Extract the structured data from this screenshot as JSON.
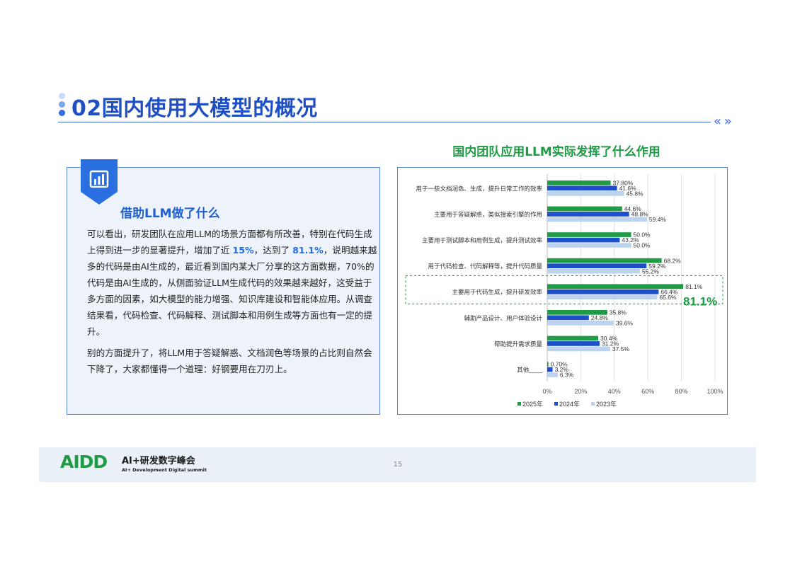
{
  "header": {
    "title": "02国内使用大模型的概况",
    "dot_colors": [
      "#c9dafc",
      "#7ea6ef",
      "#2f6ee3"
    ]
  },
  "text_box": {
    "heading": "借助LLM做了什么",
    "para1": {
      "part1": "可以看出，研发团队在应用LLM的场景方面都有所改善，特别在代码生成上得到进一步的显著提升，增加了近 ",
      "hl1": "15%",
      "part2": "，达到了 ",
      "hl2": "81.1%",
      "part3": "，说明越来越多的代码是由AI生成的，最近看到国内某大厂分享的这方面数据，70%的代码是由AI生成的，从侧面验证LLM生成代码的效果越来越好，这受益于多方面的因素，如大模型的能力增强、知识库建设和智能体应用。从调查结果看，代码检查、代码解释、测试脚本和用例生成等方面也有一定的提升。"
    },
    "para2": "别的方面提升了，将LLM用于答疑解惑、文档润色等场景的占比则自然会下降了，大家都懂得一个道理：好钢要用在刀刃上。"
  },
  "chart_data": {
    "type": "bar",
    "orientation": "horizontal",
    "title": "国内团队应用LLM实际发挥了什么作用",
    "categories": [
      "用于一些文档润色、生成，提升日常工作的效率",
      "主要用于答疑解惑，类似搜索引擎的作用",
      "主要用于测试脚本和用例生成，提升测试效率",
      "用于代码检查、代码解释等，提升代码质量",
      "主要用于代码生成，提升研发效率",
      "辅助产品设计、用户体验设计",
      "帮助提升需求质量",
      "其他____"
    ],
    "series": [
      {
        "name": "2025年",
        "color": "#1f9a45",
        "values": [
          37.8,
          44.6,
          50.0,
          68.2,
          81.1,
          35.8,
          30.4,
          0.7
        ],
        "labels": [
          "37.80%",
          "44.6%",
          "50.0%",
          "68.2%",
          "81.1%",
          "35.8%",
          "30.4%",
          "0.70%"
        ]
      },
      {
        "name": "2024年",
        "color": "#1c4fc9",
        "values": [
          41.6,
          48.8,
          43.2,
          59.2,
          66.4,
          24.8,
          31.2,
          3.2
        ],
        "labels": [
          "41.6%",
          "48.8%",
          "43.2%",
          "59.2%",
          "66.4%",
          "24.8%",
          "31.2%",
          "3.2%"
        ]
      },
      {
        "name": "2023年",
        "color": "#bcd3ef",
        "values": [
          45.8,
          59.4,
          50.0,
          55.2,
          65.6,
          39.6,
          37.5,
          6.3
        ],
        "labels": [
          "45.8%",
          "59.4%",
          "50.0%",
          "55.2%",
          "65.6%",
          "39.6%",
          "37.5%",
          "6.3%"
        ]
      }
    ],
    "xlim": [
      0,
      100
    ],
    "xticks": [
      "0%",
      "20%",
      "40%",
      "60%",
      "80%",
      "100%"
    ],
    "legend_position": "bottom",
    "highlight": {
      "category_index": 4,
      "label": "81.1%",
      "color": "#1f9a45"
    }
  },
  "footer": {
    "logo_letters": "AIDD",
    "logo_name": "AI+研发数字峰会",
    "logo_sub": "AI+ Development Digital summit",
    "page_number": "15",
    "logo_color": "#1f9a45",
    "logo_color2": "#1c4fc9"
  }
}
